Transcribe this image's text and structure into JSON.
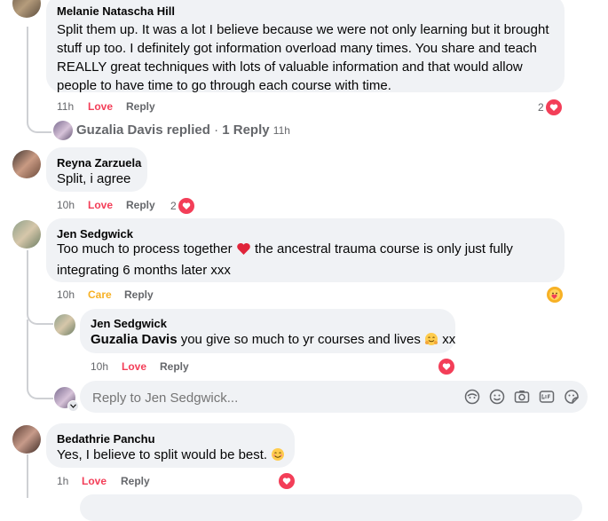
{
  "comments": [
    {
      "author": "Melanie Natascha Hill",
      "text_lines": [
        "Split them up. It was a lot I believe because we were not only learning but it brought",
        "stuff up too. I definitely got information overload many times. You share and teach",
        "REALLY great techniques with lots of valuable information and that would allow",
        "people to have time to go through each course with time."
      ],
      "time": "11h",
      "reaction_label": "Love",
      "reply_label": "Reply",
      "reaction_count": "2"
    },
    {
      "author": "Reyna Zarzuela",
      "text": "Split, i agree",
      "time": "10h",
      "reaction_label": "Love",
      "reply_label": "Reply",
      "reaction_count": "2"
    },
    {
      "author": "Jen Sedgwick",
      "text_line1_before": "Too much to process together",
      "text_line1_after": "the ancestral trauma course is only just fully",
      "text_line2": "integrating 6 months later xxx",
      "time": "10h",
      "reaction_label": "Care",
      "reply_label": "Reply"
    },
    {
      "author": "Bedathrie Panchu",
      "text": "Yes, I believe to split would be best.",
      "time": "1h",
      "reaction_label": "Love",
      "reply_label": "Reply"
    }
  ],
  "replied_summary": {
    "name": "Guzalia Davis",
    "replied_text": "replied",
    "separator": "·",
    "count_text": "1 Reply",
    "time": "11h"
  },
  "nested_reply": {
    "author": "Jen Sedgwick",
    "mention": "Guzalia Davis",
    "text": "you give so much to yr courses and lives",
    "suffix": "xx",
    "time": "10h",
    "reaction_label": "Love",
    "reply_label": "Reply"
  },
  "reply_input": {
    "placeholder": "Reply to Jen Sedgwick..."
  },
  "colors": {
    "love": "#f33e58",
    "care": "#f7b125",
    "bubble": "#f0f2f5",
    "meta": "#65676b"
  }
}
